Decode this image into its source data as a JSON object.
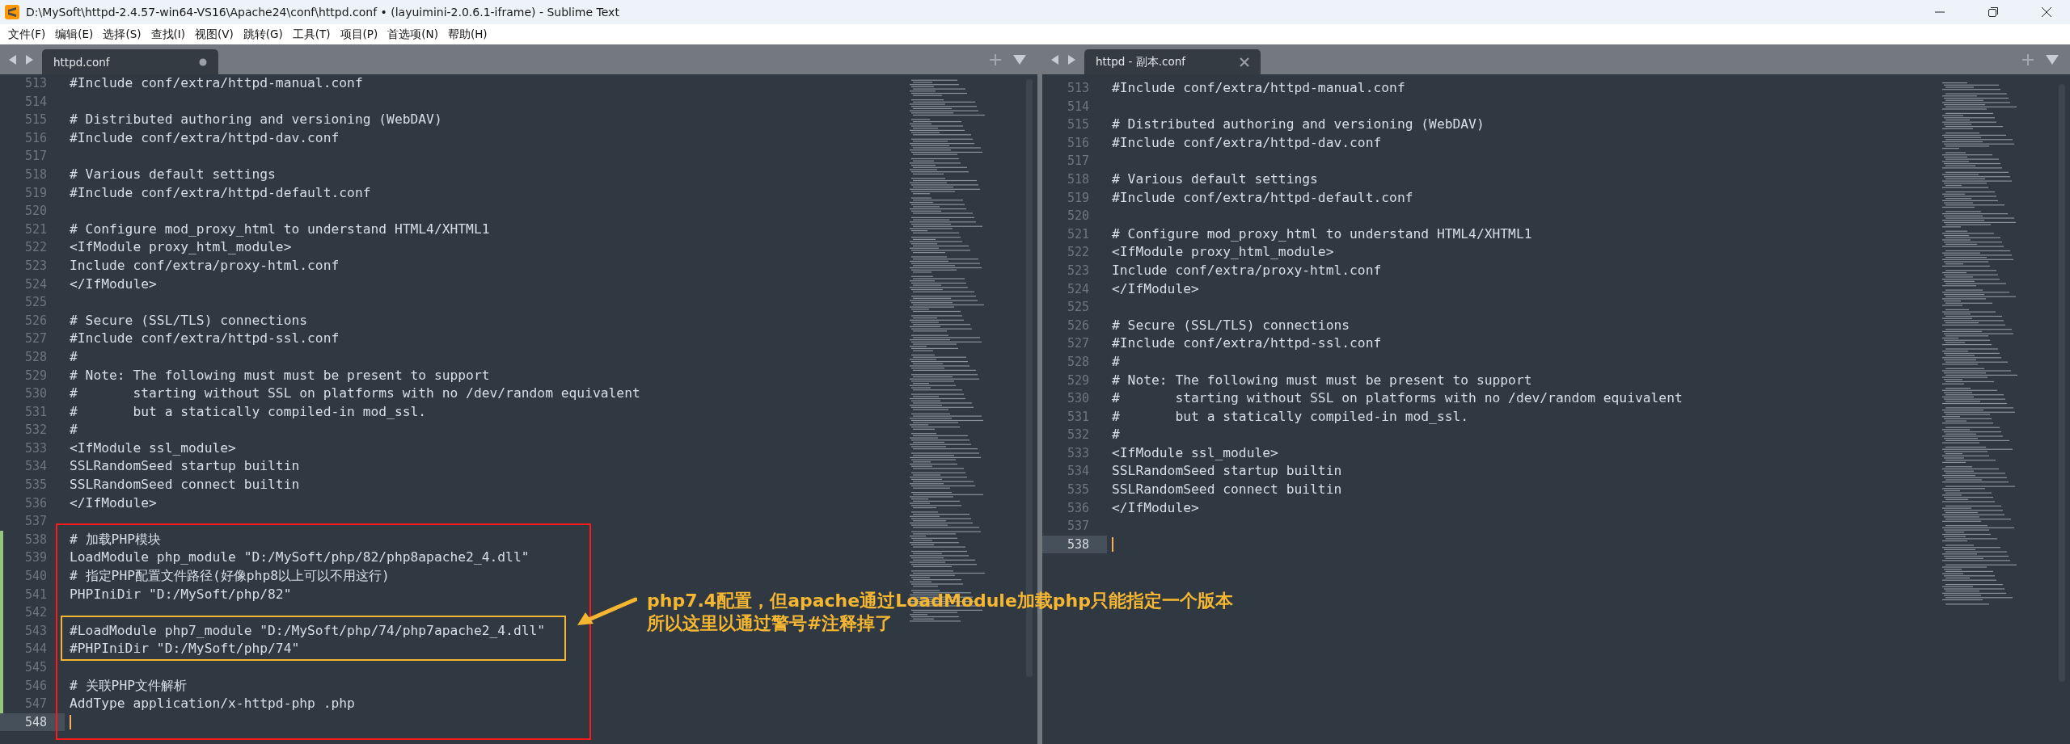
{
  "window": {
    "title": "D:\\MySoft\\httpd-2.4.57-win64-VS16\\Apache24\\conf\\httpd.conf • (layuimini-2.0.6.1-iframe) - Sublime Text"
  },
  "menu": [
    "文件(F)",
    "编辑(E)",
    "选择(S)",
    "查找(I)",
    "视图(V)",
    "跳转(G)",
    "工具(T)",
    "项目(P)",
    "首选项(N)",
    "帮助(H)"
  ],
  "panes": [
    {
      "tab": {
        "label": "httpd.conf",
        "selected": true,
        "dirty": true
      },
      "lines": [
        {
          "number": "513",
          "text": "#Include conf/extra/httpd-manual.conf",
          "modified": false,
          "current": false
        },
        {
          "number": "514",
          "modified": false,
          "current": false
        },
        {
          "number": "515",
          "text": "# Distributed authoring and versioning (WebDAV)",
          "modified": false,
          "current": false
        },
        {
          "number": "516",
          "text": "#Include conf/extra/httpd-dav.conf",
          "modified": false,
          "current": false
        },
        {
          "number": "517",
          "modified": false,
          "current": false
        },
        {
          "number": "518",
          "text": "# Various default settings",
          "modified": false,
          "current": false
        },
        {
          "number": "519",
          "text": "#Include conf/extra/httpd-default.conf",
          "modified": false,
          "current": false
        },
        {
          "number": "520",
          "modified": false,
          "current": false
        },
        {
          "number": "521",
          "text": "# Configure mod_proxy_html to understand HTML4/XHTML1",
          "modified": false,
          "current": false
        },
        {
          "number": "522",
          "text": "<IfModule proxy_html_module>",
          "modified": false,
          "current": false
        },
        {
          "number": "523",
          "text": "Include conf/extra/proxy-html.conf",
          "modified": false,
          "current": false
        },
        {
          "number": "524",
          "text": "</IfModule>",
          "modified": false,
          "current": false
        },
        {
          "number": "525",
          "modified": false,
          "current": false
        },
        {
          "number": "526",
          "text": "# Secure (SSL/TLS) connections",
          "modified": false,
          "current": false
        },
        {
          "number": "527",
          "text": "#Include conf/extra/httpd-ssl.conf",
          "modified": false,
          "current": false
        },
        {
          "number": "528",
          "text": "#",
          "modified": false,
          "current": false
        },
        {
          "number": "529",
          "text": "# Note: The following must must be present to support",
          "modified": false,
          "current": false
        },
        {
          "number": "530",
          "text": "#       starting without SSL on platforms with no /dev/random equivalent",
          "modified": false,
          "current": false
        },
        {
          "number": "531",
          "text": "#       but a statically compiled-in mod_ssl.",
          "modified": false,
          "current": false
        },
        {
          "number": "532",
          "text": "#",
          "modified": false,
          "current": false
        },
        {
          "number": "533",
          "text": "<IfModule ssl_module>",
          "modified": false,
          "current": false
        },
        {
          "number": "534",
          "text": "SSLRandomSeed startup builtin",
          "modified": false,
          "current": false
        },
        {
          "number": "535",
          "text": "SSLRandomSeed connect builtin",
          "modified": false,
          "current": false
        },
        {
          "number": "536",
          "text": "</IfModule>",
          "modified": false,
          "current": false
        },
        {
          "number": "537",
          "modified": false,
          "current": false
        },
        {
          "number": "538",
          "text": "# 加载PHP模块",
          "modified": true,
          "current": false
        },
        {
          "number": "539",
          "text": "LoadModule php_module \"D:/MySoft/php/82/php8apache2_4.dll\"",
          "modified": true,
          "current": false
        },
        {
          "number": "540",
          "text": "# 指定PHP配置文件路径(好像php8以上可以不用这行)",
          "modified": true,
          "current": false
        },
        {
          "number": "541",
          "text": "PHPIniDir \"D:/MySoft/php/82\"",
          "modified": true,
          "current": false
        },
        {
          "number": "542",
          "modified": true,
          "current": false
        },
        {
          "number": "543",
          "text": "#LoadModule php7_module \"D:/MySoft/php/74/php7apache2_4.dll\"",
          "modified": true,
          "current": false
        },
        {
          "number": "544",
          "text": "#PHPIniDir \"D:/MySoft/php/74\"",
          "modified": true,
          "current": false
        },
        {
          "number": "545",
          "modified": true,
          "current": false
        },
        {
          "number": "546",
          "text": "# 关联PHP文件解析",
          "modified": true,
          "current": false
        },
        {
          "number": "547",
          "text": "AddType application/x-httpd-php .php",
          "modified": true,
          "current": false
        },
        {
          "number": "548",
          "modified": false,
          "current": true
        }
      ]
    },
    {
      "tab": {
        "label": "httpd - 副本.conf",
        "selected": true,
        "dirty": false
      },
      "lines": [
        {
          "number": "513",
          "text": "#Include conf/extra/httpd-manual.conf",
          "modified": false,
          "current": false
        },
        {
          "number": "514",
          "modified": false,
          "current": false
        },
        {
          "number": "515",
          "text": "# Distributed authoring and versioning (WebDAV)",
          "modified": false,
          "current": false
        },
        {
          "number": "516",
          "text": "#Include conf/extra/httpd-dav.conf",
          "modified": false,
          "current": false
        },
        {
          "number": "517",
          "modified": false,
          "current": false
        },
        {
          "number": "518",
          "text": "# Various default settings",
          "modified": false,
          "current": false
        },
        {
          "number": "519",
          "text": "#Include conf/extra/httpd-default.conf",
          "modified": false,
          "current": false
        },
        {
          "number": "520",
          "modified": false,
          "current": false
        },
        {
          "number": "521",
          "text": "# Configure mod_proxy_html to understand HTML4/XHTML1",
          "modified": false,
          "current": false
        },
        {
          "number": "522",
          "text": "<IfModule proxy_html_module>",
          "modified": false,
          "current": false
        },
        {
          "number": "523",
          "text": "Include conf/extra/proxy-html.conf",
          "modified": false,
          "current": false
        },
        {
          "number": "524",
          "text": "</IfModule>",
          "modified": false,
          "current": false
        },
        {
          "number": "525",
          "modified": false,
          "current": false
        },
        {
          "number": "526",
          "text": "# Secure (SSL/TLS) connections",
          "modified": false,
          "current": false
        },
        {
          "number": "527",
          "text": "#Include conf/extra/httpd-ssl.conf",
          "modified": false,
          "current": false
        },
        {
          "number": "528",
          "text": "#",
          "modified": false,
          "current": false
        },
        {
          "number": "529",
          "text": "# Note: The following must must be present to support",
          "modified": false,
          "current": false
        },
        {
          "number": "530",
          "text": "#       starting without SSL on platforms with no /dev/random equivalent",
          "modified": false,
          "current": false
        },
        {
          "number": "531",
          "text": "#       but a statically compiled-in mod_ssl.",
          "modified": false,
          "current": false
        },
        {
          "number": "532",
          "text": "#",
          "modified": false,
          "current": false
        },
        {
          "number": "533",
          "text": "<IfModule ssl_module>",
          "modified": false,
          "current": false
        },
        {
          "number": "534",
          "text": "SSLRandomSeed startup builtin",
          "modified": false,
          "current": false
        },
        {
          "number": "535",
          "text": "SSLRandomSeed connect builtin",
          "modified": false,
          "current": false
        },
        {
          "number": "536",
          "text": "</IfModule>",
          "modified": false,
          "current": false
        },
        {
          "number": "537",
          "modified": false,
          "current": false
        },
        {
          "number": "538",
          "modified": false,
          "current": true
        }
      ]
    }
  ],
  "annotation": {
    "lines": [
      "php7.4配置，但apache通过LoadModule加载php只能指定一个版本",
      "所以这里以通过警号#注释掉了"
    ]
  }
}
